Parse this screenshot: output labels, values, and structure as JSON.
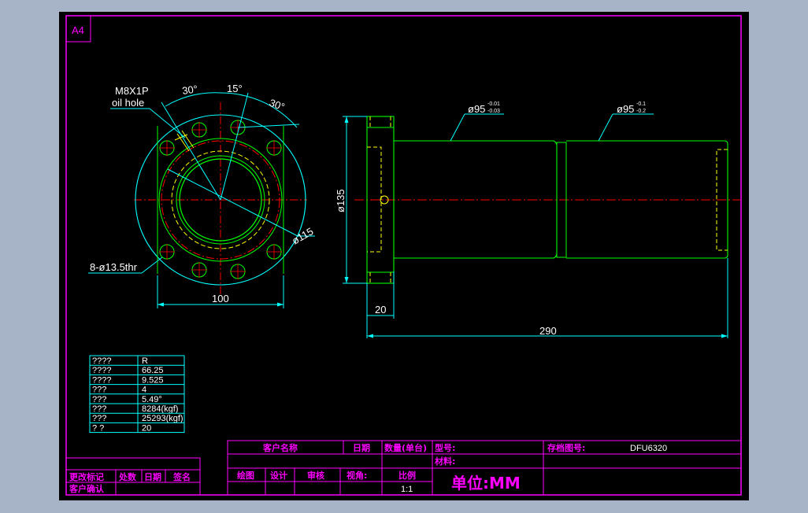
{
  "sheet": {
    "size_label": "A4",
    "background_color": "#a7b3c6",
    "paper_color": "#000000"
  },
  "colors": {
    "frame": "#ff00ff",
    "outline": "#00ff00",
    "hidden": "#ffff00",
    "center": "#ff0000",
    "dimension": "#00ffff",
    "text": "#ffffff"
  },
  "front_view": {
    "callout_line1": "M8X1P",
    "callout_line2": "oil hole",
    "angle_left": "30°",
    "angle_middle": "15°",
    "angle_right": "30°",
    "bolt_circle_dia": "ø115",
    "holes_note": "8-ø13.5thr",
    "flange_width": "100"
  },
  "side_view": {
    "flange_dia": "ø135",
    "shaft_dia_1": "ø95",
    "shaft_dia_1_tol_upper": "-0.01",
    "shaft_dia_1_tol_lower": "-0.03",
    "shaft_dia_2": "ø95",
    "shaft_dia_2_tol_upper": "-0.1",
    "shaft_dia_2_tol_lower": "-0.2",
    "flange_thickness": "20",
    "total_length": "290"
  },
  "spec_table": {
    "rows": [
      {
        "label": "????",
        "value": "R"
      },
      {
        "label": "????",
        "value": "66.25"
      },
      {
        "label": "????",
        "value": "9.525"
      },
      {
        "label": "???",
        "value": "4"
      },
      {
        "label": "???",
        "value": "5.49°"
      },
      {
        "label": "???",
        "value": "8284(kgf)"
      },
      {
        "label": "???",
        "value": "25293(kgf)"
      },
      {
        "label": "?   ?",
        "value": "20"
      }
    ]
  },
  "revision_block": {
    "row1": [
      "更改标记",
      "处数",
      "日期",
      "签名"
    ],
    "row2": [
      "客户确认"
    ]
  },
  "title_block": {
    "customer_name": "客户名称",
    "date": "日期",
    "quantity": "数量(单台)",
    "model": "型号:",
    "archive_no": "存档图号:",
    "archive_value": "DFU6320",
    "material": "材料:",
    "drawn": "绘图",
    "design": "设计",
    "review": "审核",
    "view_angle": "视角:",
    "scale": "比例",
    "scale_value": "1:1",
    "unit": "单位:MM"
  }
}
